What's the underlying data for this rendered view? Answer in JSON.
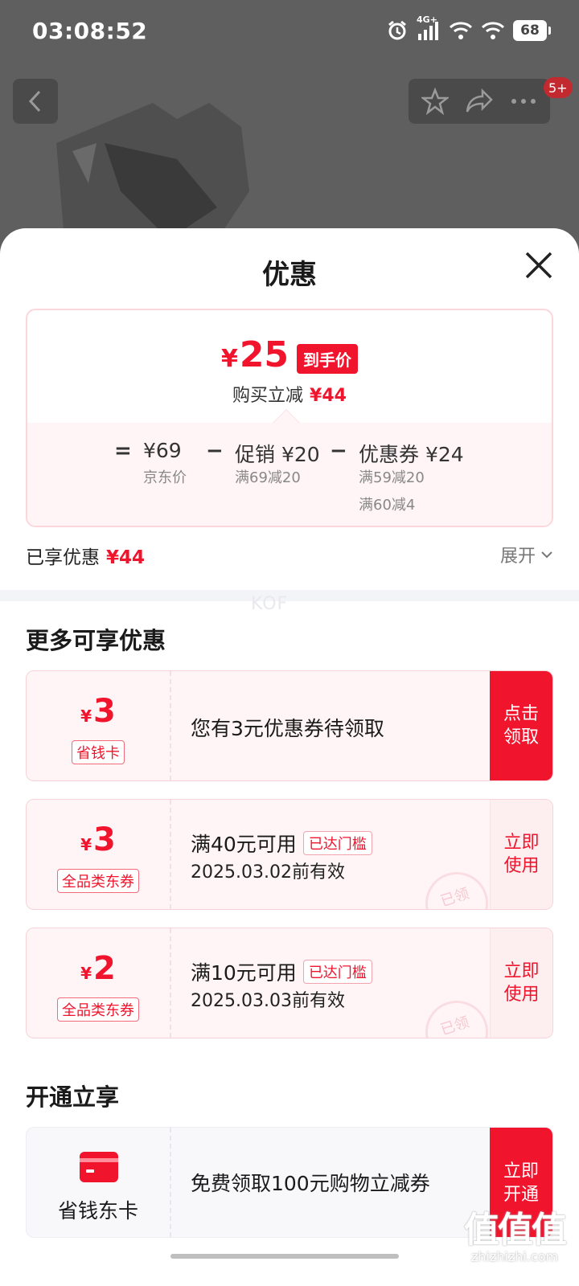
{
  "status_bar": {
    "time": "03:08:52",
    "network": "4G+",
    "battery": "68"
  },
  "top_nav": {
    "badge": "5+"
  },
  "sheet": {
    "title": "优惠",
    "summary": {
      "currency": "¥",
      "final_price": "25",
      "final_tag": "到手价",
      "reduce_label": "购买立减",
      "reduce_amount": "¥44",
      "calc": {
        "equals": "=",
        "base_amount": "¥69",
        "base_label": "京东价",
        "minus1": "−",
        "promo_label": "促销",
        "promo_amount": "¥20",
        "promo_rule": "满69减20",
        "minus2": "−",
        "coupon_label": "优惠券",
        "coupon_amount": "¥24",
        "coupon_rule1": "满59减20",
        "coupon_rule2": "满60减4"
      }
    },
    "enjoyed_label": "已享优惠",
    "enjoyed_amount": "¥44",
    "expand_label": "展开",
    "watermark": "KOF",
    "more_title": "更多可享优惠",
    "coupons": [
      {
        "currency": "¥",
        "amount": "3",
        "tag": "省钱卡",
        "desc": "您有3元优惠券待领取",
        "cta": "点击领取"
      },
      {
        "currency": "¥",
        "amount": "3",
        "tag": "全品类东券",
        "condition": "满40元可用",
        "status": "已达门槛",
        "validity": "2025.03.02前有效",
        "cta": "立即使用",
        "stamp": "已领"
      },
      {
        "currency": "¥",
        "amount": "2",
        "tag": "全品类东券",
        "condition": "满10元可用",
        "status": "已达门槛",
        "validity": "2025.03.03前有效",
        "cta": "立即使用",
        "stamp": "已领"
      }
    ],
    "open_title": "开通立享",
    "open_card": {
      "label": "省钱东卡",
      "desc": "免费领取100元购物立减券",
      "cta": "立即开通"
    },
    "site_watermark": {
      "logo": "值值值",
      "url": "zhizhizhi.com"
    }
  },
  "colors": {
    "accent": "#f0142d",
    "overlay": "#5f5f5f"
  }
}
